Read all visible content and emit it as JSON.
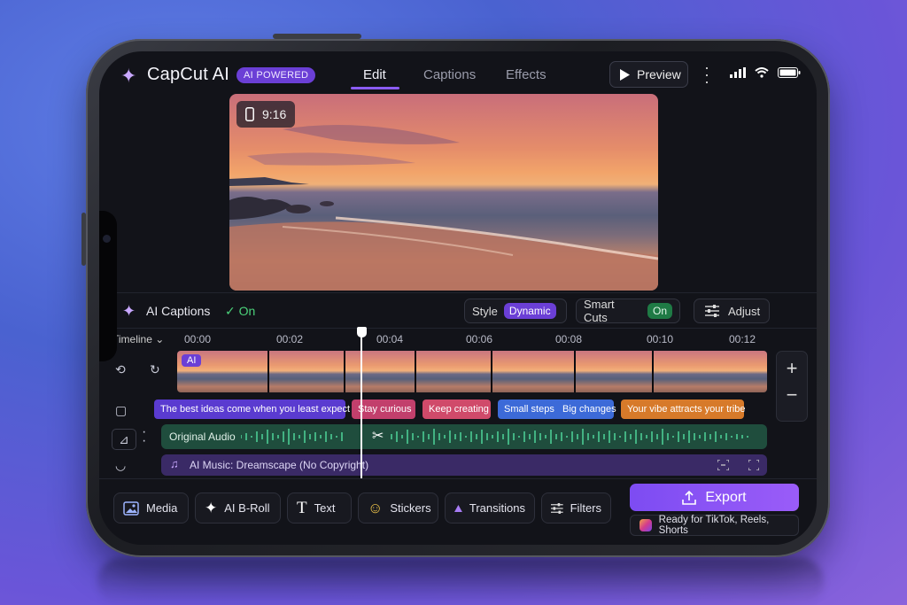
{
  "app": {
    "name": "CapCut AI",
    "badge": "AI POWERED"
  },
  "tabs": [
    {
      "label": "Edit",
      "active": true
    },
    {
      "label": "Captions",
      "active": false
    },
    {
      "label": "Effects",
      "active": false
    }
  ],
  "header": {
    "preview_label": "Preview"
  },
  "video": {
    "aspect_ratio": "9:16"
  },
  "captions_bar": {
    "label": "AI Captions",
    "status": "On",
    "style_label": "Style",
    "style_value": "Dynamic",
    "smart_cuts_label": "Smart Cuts",
    "smart_cuts_value": "On",
    "adjust_label": "Adjust"
  },
  "timeline": {
    "label": "Timeline",
    "ticks": [
      "00:00",
      "00:02",
      "00:04",
      "00:06",
      "00:08",
      "00:10",
      "00:12"
    ],
    "ai_mark": "AI",
    "captions": [
      {
        "text": "The best ideas come when you least expect them.",
        "color": "#5a3bd0"
      },
      {
        "text": "Stay curious",
        "color": "#c23f6c"
      },
      {
        "text": "Keep creating",
        "color": "#d04a6a"
      },
      {
        "text": "Small steps   Big changes",
        "color": "#3c6ad8"
      },
      {
        "text": "Your vibe attracts your tribe",
        "color": "#d77a2a"
      }
    ],
    "audio_label": "Original Audio",
    "music_label": "AI Music: Dreamscape (No Copyright)"
  },
  "toolbar": {
    "items": [
      "Media",
      "AI B-Roll",
      "Text",
      "Stickers",
      "Transitions",
      "Filters"
    ],
    "export_label": "Export",
    "ready_label": "Ready for TikTok, Reels, Shorts"
  },
  "colors": {
    "accent": "#8b5cf6",
    "on_green": "#4bd27a"
  }
}
